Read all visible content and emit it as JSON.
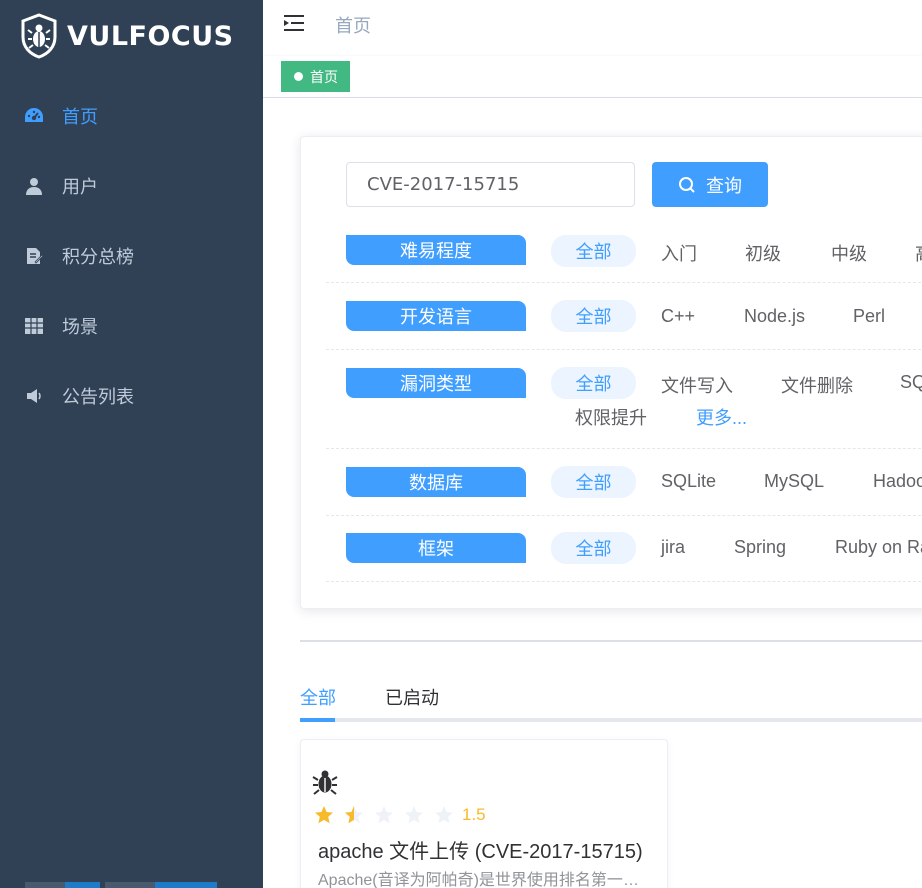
{
  "app": {
    "name": "VULFOCUS"
  },
  "sidebar": {
    "items": [
      {
        "label": "首页",
        "icon": "dashboard-icon",
        "active": true
      },
      {
        "label": "用户",
        "icon": "user-icon",
        "active": false
      },
      {
        "label": "积分总榜",
        "icon": "edit-doc-icon",
        "active": false
      },
      {
        "label": "场景",
        "icon": "grid-icon",
        "active": false
      },
      {
        "label": "公告列表",
        "icon": "megaphone-icon",
        "active": false
      }
    ]
  },
  "header": {
    "breadcrumb": "首页"
  },
  "tags_view": {
    "active_tag": "首页"
  },
  "search": {
    "value": "CVE-2017-15715",
    "button_label": "查询"
  },
  "filters": [
    {
      "label": "难易程度",
      "options": [
        "全部",
        "入门",
        "初级",
        "中级",
        "高"
      ]
    },
    {
      "label": "开发语言",
      "options": [
        "全部",
        "C++",
        "Node.js",
        "Perl"
      ]
    },
    {
      "label": "漏洞类型",
      "options": [
        "全部",
        "文件写入",
        "文件删除",
        "SQ",
        "权限提升"
      ],
      "more_label": "更多..."
    },
    {
      "label": "数据库",
      "options": [
        "全部",
        "SQLite",
        "MySQL",
        "Hadoo"
      ]
    },
    {
      "label": "框架",
      "options": [
        "全部",
        "jira",
        "Spring",
        "Ruby on Ra"
      ]
    }
  ],
  "tabs": [
    {
      "label": "全部",
      "active": true
    },
    {
      "label": "已启动",
      "active": false
    }
  ],
  "cards": [
    {
      "rating": 1.5,
      "rating_text": "1.5",
      "title": "apache 文件上传 (CVE-2017-15715)",
      "description": "Apache(音译为阿帕奇)是世界使用排名第一的Web服务器软件"
    }
  ],
  "colors": {
    "sidebar_bg": "#304156",
    "accent": "#409eff",
    "tag_green": "#42b983",
    "star": "#f7ba2a"
  }
}
